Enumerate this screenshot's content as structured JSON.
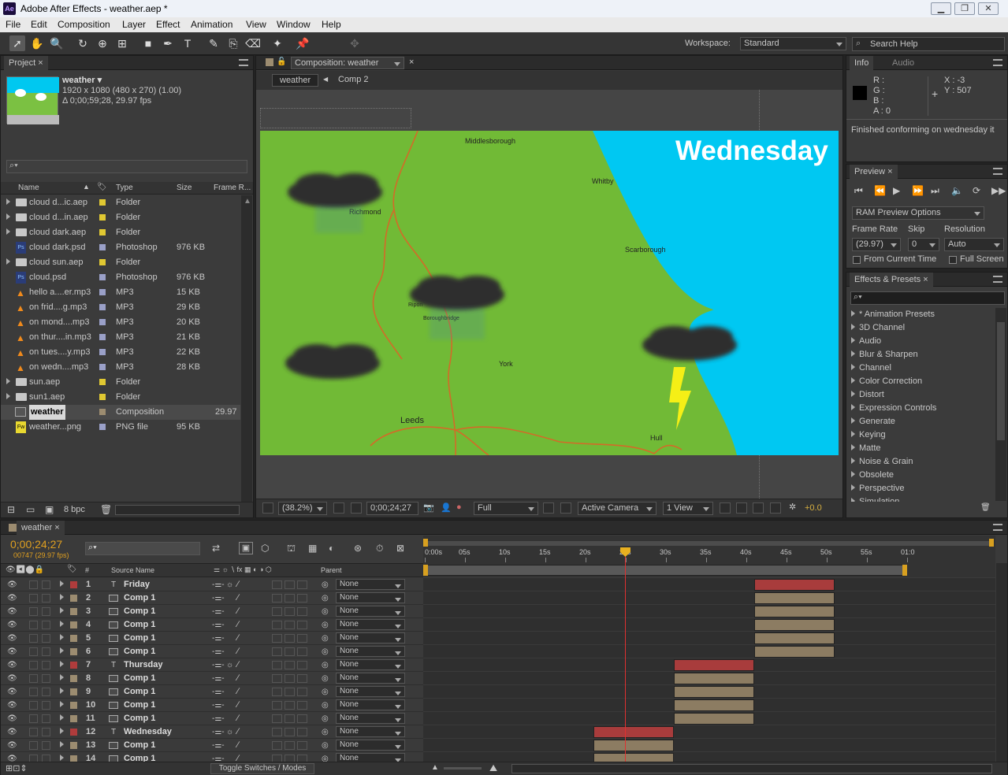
{
  "window": {
    "title": "Adobe After Effects - weather.aep *",
    "logo": "Ae"
  },
  "menu": [
    "File",
    "Edit",
    "Composition",
    "Layer",
    "Effect",
    "Animation",
    "View",
    "Window",
    "Help"
  ],
  "workspace": {
    "label": "Workspace:",
    "value": "Standard"
  },
  "search_help": "Search Help",
  "project": {
    "tab": "Project",
    "item_name": "weather ▾",
    "dims": "1920 x 1080  (480 x 270) (1.00)",
    "duration": "Δ 0;00;59;28, 29.97 fps",
    "columns": [
      "Name",
      "Type",
      "Size",
      "Frame R..."
    ],
    "items": [
      {
        "name": "cloud d...ic.aep",
        "type": "Folder",
        "size": "",
        "fr": "",
        "icon": "folder",
        "color": "#e0c832"
      },
      {
        "name": "cloud d...in.aep",
        "type": "Folder",
        "size": "",
        "fr": "",
        "icon": "folder",
        "color": "#e0c832"
      },
      {
        "name": "cloud dark.aep",
        "type": "Folder",
        "size": "",
        "fr": "",
        "icon": "folder",
        "color": "#e0c832"
      },
      {
        "name": "cloud dark.psd",
        "type": "Photoshop",
        "size": "976 KB",
        "fr": "",
        "icon": "ps",
        "color": "#9aa0c8"
      },
      {
        "name": "cloud sun.aep",
        "type": "Folder",
        "size": "",
        "fr": "",
        "icon": "folder",
        "color": "#e0c832"
      },
      {
        "name": "cloud.psd",
        "type": "Photoshop",
        "size": "976 KB",
        "fr": "",
        "icon": "ps",
        "color": "#9aa0c8"
      },
      {
        "name": "hello a....er.mp3",
        "type": "MP3",
        "size": "15 KB",
        "fr": "",
        "icon": "mp3",
        "color": "#9aa0c8"
      },
      {
        "name": "on frid....g.mp3",
        "type": "MP3",
        "size": "29 KB",
        "fr": "",
        "icon": "mp3",
        "color": "#9aa0c8"
      },
      {
        "name": "on mond....mp3",
        "type": "MP3",
        "size": "20 KB",
        "fr": "",
        "icon": "mp3",
        "color": "#9aa0c8"
      },
      {
        "name": "on thur....in.mp3",
        "type": "MP3",
        "size": "21 KB",
        "fr": "",
        "icon": "mp3",
        "color": "#9aa0c8"
      },
      {
        "name": "on tues....y.mp3",
        "type": "MP3",
        "size": "22 KB",
        "fr": "",
        "icon": "mp3",
        "color": "#9aa0c8"
      },
      {
        "name": "on wedn....mp3",
        "type": "MP3",
        "size": "28 KB",
        "fr": "",
        "icon": "mp3",
        "color": "#9aa0c8"
      },
      {
        "name": "sun.aep",
        "type": "Folder",
        "size": "",
        "fr": "",
        "icon": "folder",
        "color": "#e0c832"
      },
      {
        "name": "sun1.aep",
        "type": "Folder",
        "size": "",
        "fr": "",
        "icon": "folder",
        "color": "#e0c832"
      },
      {
        "name": "weather",
        "type": "Composition",
        "size": "",
        "fr": "29.97",
        "icon": "comp",
        "color": "#9c8c70"
      },
      {
        "name": "weather...png",
        "type": "PNG file",
        "size": "95 KB",
        "fr": "",
        "icon": "png",
        "color": "#9aa0c8"
      }
    ],
    "bpc": "8 bpc"
  },
  "comp": {
    "tab": "Composition: weather",
    "crumbs": [
      "weather",
      "Comp 2"
    ],
    "title_text": "Wednesday",
    "towns": [
      "Middlesborough",
      "Whitby",
      "Richmond",
      "Scarborough",
      "Ripon",
      "Boroughbridge",
      "York",
      "Leeds",
      "Hull"
    ],
    "footer": {
      "zoom": "(38.2%)",
      "time": "0;00;24;27",
      "res": "Full",
      "camera": "Active Camera",
      "views": "1 View",
      "exposure": "+0.0"
    }
  },
  "info": {
    "tabs": [
      "Info",
      "Audio"
    ],
    "r": "R :",
    "g": "G :",
    "b": "B :",
    "a": "A : 0",
    "x": "X : -3",
    "y": "Y : 507",
    "msg": "Finished conforming on wednesday it"
  },
  "preview": {
    "tab": "Preview",
    "ram": "RAM Preview Options",
    "fr_label": "Frame Rate",
    "skip_label": "Skip",
    "res_label": "Resolution",
    "fr": "(29.97)",
    "skip": "0",
    "res": "Auto",
    "from_current": "From Current Time",
    "full_screen": "Full Screen"
  },
  "effects": {
    "tab": "Effects & Presets",
    "items": [
      "* Animation Presets",
      "3D Channel",
      "Audio",
      "Blur & Sharpen",
      "Channel",
      "Color Correction",
      "Distort",
      "Expression Controls",
      "Generate",
      "Keying",
      "Matte",
      "Noise & Grain",
      "Obsolete",
      "Perspective",
      "Simulation"
    ]
  },
  "timeline": {
    "tab": "weather",
    "timecode": "0;00;24;27",
    "frames": "00747 (29.97 fps)",
    "col_source": "Source Name",
    "col_parent": "Parent",
    "col_num": "#",
    "ruler": [
      "0:00s",
      "05s",
      "10s",
      "15s",
      "20s",
      "25s",
      "30s",
      "35s",
      "40s",
      "45s",
      "50s",
      "55s",
      "01:0"
    ],
    "current_time_s": 24.9,
    "duration_s": 60,
    "layers": [
      {
        "n": "1",
        "name": "Friday",
        "type": "T",
        "color": "#b03c3c",
        "parent": "None",
        "in": 41,
        "out": 51
      },
      {
        "n": "2",
        "name": "Comp 1",
        "type": "C",
        "color": "#9c8c70",
        "parent": "None",
        "in": 41,
        "out": 51
      },
      {
        "n": "3",
        "name": "Comp 1",
        "type": "C",
        "color": "#9c8c70",
        "parent": "None",
        "in": 41,
        "out": 51
      },
      {
        "n": "4",
        "name": "Comp 1",
        "type": "C",
        "color": "#9c8c70",
        "parent": "None",
        "in": 41,
        "out": 51
      },
      {
        "n": "5",
        "name": "Comp 1",
        "type": "C",
        "color": "#9c8c70",
        "parent": "None",
        "in": 41,
        "out": 51
      },
      {
        "n": "6",
        "name": "Comp 1",
        "type": "C",
        "color": "#9c8c70",
        "parent": "None",
        "in": 41,
        "out": 51
      },
      {
        "n": "7",
        "name": "Thursday",
        "type": "T",
        "color": "#b03c3c",
        "parent": "None",
        "in": 31,
        "out": 41
      },
      {
        "n": "8",
        "name": "Comp 1",
        "type": "C",
        "color": "#9c8c70",
        "parent": "None",
        "in": 31,
        "out": 41
      },
      {
        "n": "9",
        "name": "Comp 1",
        "type": "C",
        "color": "#9c8c70",
        "parent": "None",
        "in": 31,
        "out": 41
      },
      {
        "n": "10",
        "name": "Comp 1",
        "type": "C",
        "color": "#9c8c70",
        "parent": "None",
        "in": 31,
        "out": 41
      },
      {
        "n": "11",
        "name": "Comp 1",
        "type": "C",
        "color": "#9c8c70",
        "parent": "None",
        "in": 31,
        "out": 41
      },
      {
        "n": "12",
        "name": "Wednesday",
        "type": "T",
        "color": "#b03c3c",
        "parent": "None",
        "in": 21,
        "out": 31
      },
      {
        "n": "13",
        "name": "Comp 1",
        "type": "C",
        "color": "#9c8c70",
        "parent": "None",
        "in": 21,
        "out": 31
      },
      {
        "n": "14",
        "name": "Comp 1",
        "type": "C",
        "color": "#9c8c70",
        "parent": "None",
        "in": 21,
        "out": 31
      }
    ],
    "toggle": "Toggle Switches / Modes"
  }
}
